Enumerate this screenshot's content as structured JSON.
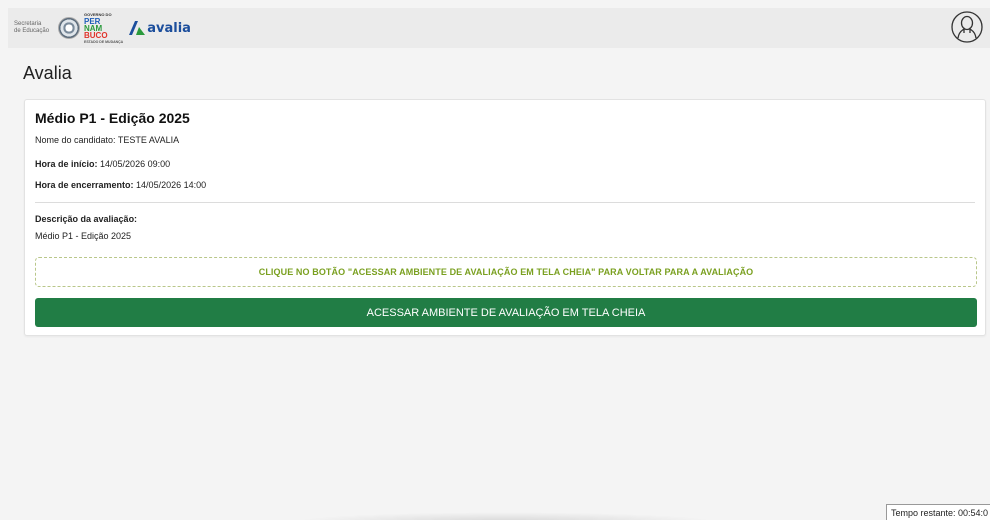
{
  "header": {
    "secretaria_text_line1": "Secretaria",
    "secretaria_text_line2": "de Educação",
    "pe_logo": {
      "top": "GOVERNO DO",
      "line1": "PER",
      "line2": "NAM",
      "line3": "BUCO",
      "bottom": "ESTADO DE MUDANÇA"
    },
    "avalia_logo_text": "avalia"
  },
  "page": {
    "title": "Avalia"
  },
  "exam": {
    "title": "Médio P1 - Edição 2025",
    "candidate_label": "Nome do candidato:",
    "candidate_value": "TESTE AVALIA",
    "start_label": "Hora de início:",
    "start_value": "14/05/2026 09:00",
    "end_label": "Hora de encerramento:",
    "end_value": "14/05/2026 14:00",
    "description_label": "Descrição da avaliação:",
    "description_value": "Médio P1 - Edição 2025"
  },
  "notice": {
    "text": "CLIQUE NO BOTÃO \"ACESSAR AMBIENTE DE AVALIAÇÃO EM TELA CHEIA\" PARA VOLTAR PARA A AVALIAÇÃO"
  },
  "actions": {
    "enter_fullscreen_label": "ACESSAR AMBIENTE DE AVALIAÇÃO EM TELA CHEIA"
  },
  "timer": {
    "text": "Tempo restante: 00:54:0"
  },
  "colors": {
    "primary_button": "#217d45",
    "notice_text": "#7aa020",
    "avalia_blue": "#1c4e9c"
  },
  "icons": {
    "user": "user-outline-icon",
    "seal": "seal-icon"
  }
}
